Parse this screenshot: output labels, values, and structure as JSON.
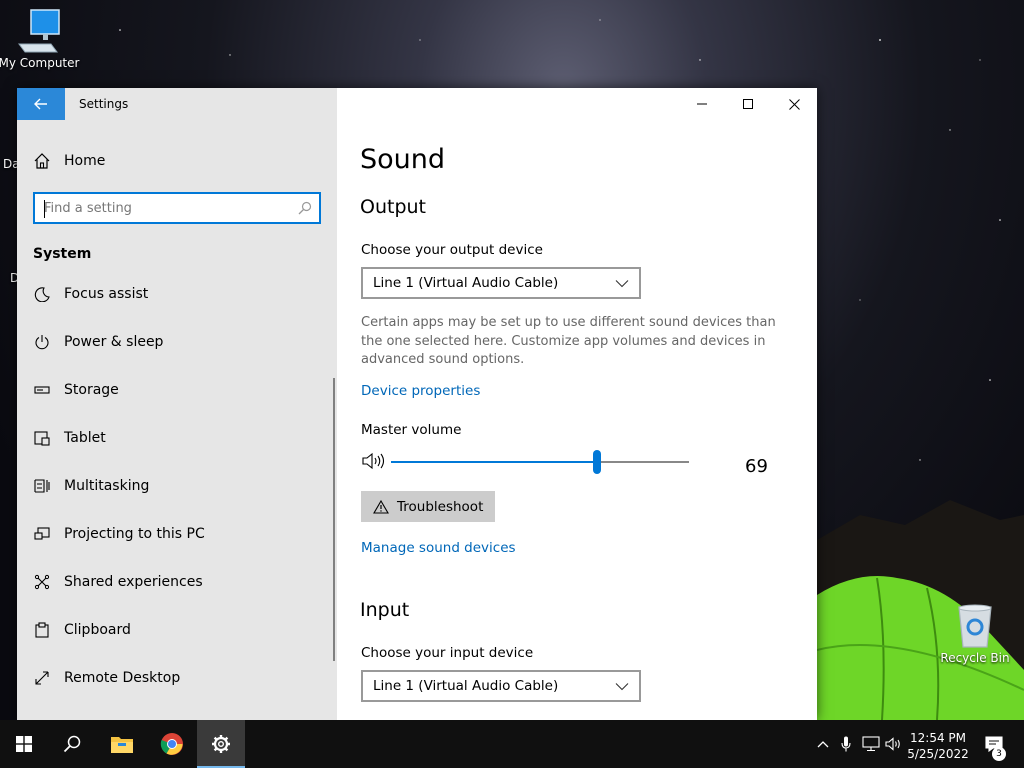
{
  "desktop": {
    "icons": [
      {
        "label": "My Computer",
        "icon": "computer-icon"
      },
      {
        "label": "Recycle Bin",
        "icon": "recycle-bin-icon"
      }
    ],
    "partial_labels": [
      "Da",
      "D"
    ]
  },
  "window": {
    "title": "Settings",
    "controls": [
      "minimize-icon",
      "maximize-icon",
      "close-icon"
    ]
  },
  "sidebar": {
    "home_label": "Home",
    "search": {
      "placeholder": "Find a setting",
      "value": ""
    },
    "section_label": "System",
    "items": [
      {
        "label": "Focus assist",
        "icon": "moon-icon"
      },
      {
        "label": "Power & sleep",
        "icon": "power-icon"
      },
      {
        "label": "Storage",
        "icon": "storage-icon"
      },
      {
        "label": "Tablet",
        "icon": "tablet-icon"
      },
      {
        "label": "Multitasking",
        "icon": "multitasking-icon"
      },
      {
        "label": "Projecting to this PC",
        "icon": "projecting-icon"
      },
      {
        "label": "Shared experiences",
        "icon": "shared-experiences-icon"
      },
      {
        "label": "Clipboard",
        "icon": "clipboard-icon"
      },
      {
        "label": "Remote Desktop",
        "icon": "remote-desktop-icon"
      }
    ]
  },
  "content": {
    "page_title": "Sound",
    "output": {
      "heading": "Output",
      "device_label": "Choose your output device",
      "device_selected": "Line 1 (Virtual Audio Cable)",
      "description": "Certain apps may be set up to use different sound devices than the one selected here. Customize app volumes and devices in advanced sound options.",
      "device_properties_link": "Device properties",
      "master_volume_label": "Master volume",
      "volume_value": "69",
      "volume_level": 0.69,
      "troubleshoot_label": "Troubleshoot",
      "manage_link": "Manage sound devices"
    },
    "input": {
      "heading": "Input",
      "device_label": "Choose your input device",
      "device_selected": "Line 1 (Virtual Audio Cable)"
    }
  },
  "taskbar": {
    "buttons": [
      "windows-start-icon",
      "search-icon",
      "file-explorer-icon",
      "chrome-icon",
      "settings-gear-icon"
    ],
    "active": "settings-gear-icon",
    "tray_icons": [
      "chevron-up-icon",
      "microphone-icon",
      "network-icon",
      "speaker-icon"
    ],
    "time": "12:54 PM",
    "date": "5/25/2022",
    "notification_count": "3"
  },
  "colors": {
    "accent": "#0078d7",
    "back_button": "#2b88d8",
    "link": "#0067b8",
    "sidebar_bg": "#e6e6e6",
    "taskbar_bg": "#101010"
  }
}
